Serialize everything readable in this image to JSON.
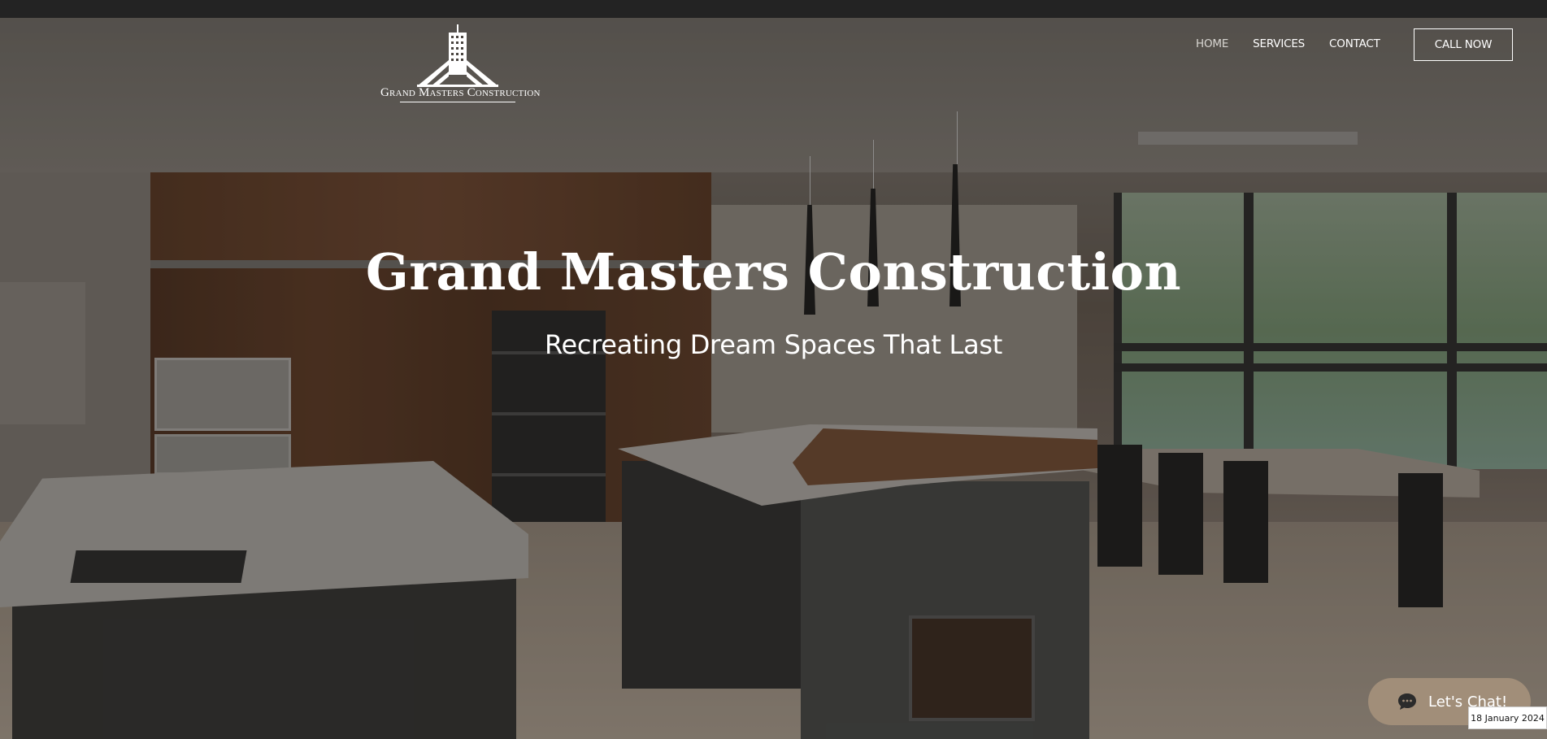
{
  "brand": {
    "logo_text": "Grand Masters Construction"
  },
  "nav": {
    "items": [
      {
        "label": "HOME",
        "active": true
      },
      {
        "label": "SERVICES",
        "active": false
      },
      {
        "label": "CONTACT",
        "active": false
      }
    ],
    "cta_label": "CALL NOW"
  },
  "hero": {
    "title": "Grand Masters Construction",
    "subtitle": "Recreating Dream Spaces That Last"
  },
  "chat": {
    "label": "Let's Chat!",
    "icon": "chat-bubble-icon"
  },
  "date_badge": "18 January 2024",
  "colors": {
    "topbar": "#232323",
    "text": "#ffffff",
    "chat_bg": "#a18e79"
  }
}
